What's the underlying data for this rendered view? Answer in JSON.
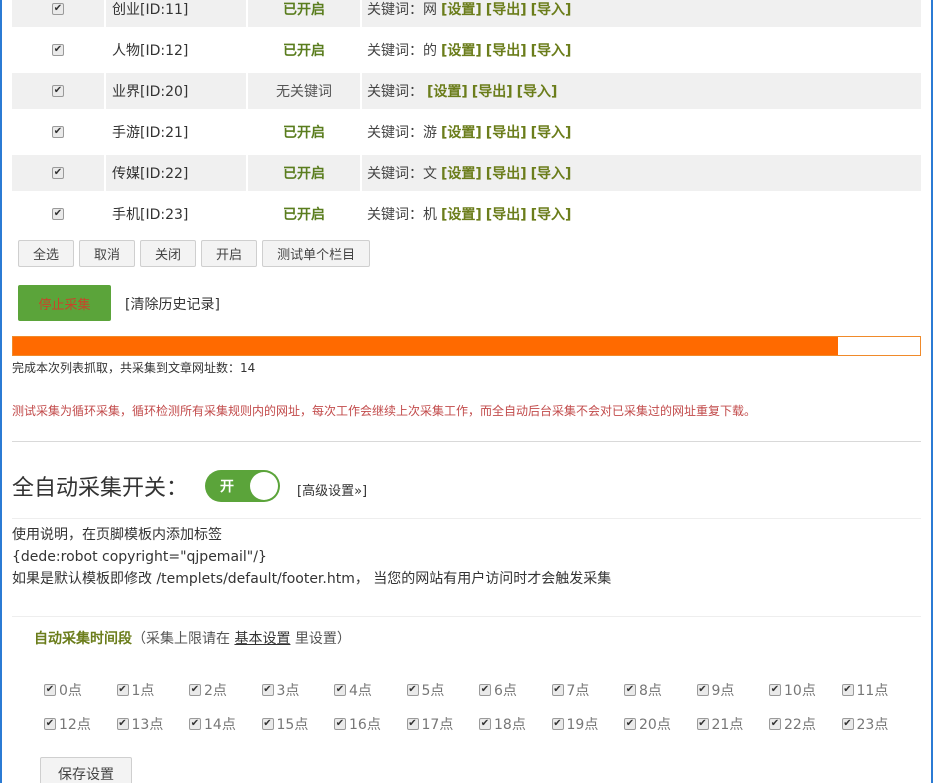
{
  "rows": [
    {
      "name": "创业[ID:11]",
      "status": "已开启",
      "active": true,
      "kw_label": "关键词：网",
      "links": [
        "[设置]",
        "[导出]",
        "[导入]"
      ]
    },
    {
      "name": "人物[ID:12]",
      "status": "已开启",
      "active": true,
      "kw_label": "关键词：的",
      "links": [
        "[设置]",
        "[导出]",
        "[导入]"
      ]
    },
    {
      "name": "业界[ID:20]",
      "status": "无关键词",
      "active": false,
      "kw_label": "关键词：",
      "links": [
        "[设置]",
        "[导出]",
        "[导入]"
      ]
    },
    {
      "name": "手游[ID:21]",
      "status": "已开启",
      "active": true,
      "kw_label": "关键词：游",
      "links": [
        "[设置]",
        "[导出]",
        "[导入]"
      ]
    },
    {
      "name": "传媒[ID:22]",
      "status": "已开启",
      "active": true,
      "kw_label": "关键词：文",
      "links": [
        "[设置]",
        "[导出]",
        "[导入]"
      ]
    },
    {
      "name": "手机[ID:23]",
      "status": "已开启",
      "active": true,
      "kw_label": "关键词：机",
      "links": [
        "[设置]",
        "[导出]",
        "[导入]"
      ]
    }
  ],
  "buttons": {
    "select_all": "全选",
    "cancel": "取消",
    "close": "关闭",
    "open": "开启",
    "test_single": "测试单个栏目"
  },
  "stop_button": "停止采集",
  "clear_history": "[清除历史记录]",
  "progress": {
    "percent": 91,
    "text": "完成本次列表抓取，共采集到文章网址数：14"
  },
  "notice": "测试采集为循环采集，循环检测所有采集规则内的网址，每次工作会继续上次采集工作，而全自动后台采集不会对已采集过的网址重复下载。",
  "auto": {
    "title": "全自动采集开关：",
    "toggle_label": "开",
    "advanced": "[高级设置»]"
  },
  "usage": {
    "line1": "使用说明，在页脚模板内添加标签",
    "line2": "{dede:robot copyright=\"qjpemail\"/}",
    "line3": "如果是默认模板即修改 /templets/default/footer.htm， 当您的网站有用户访问时才会触发采集"
  },
  "time_section": {
    "title": "自动采集时间段",
    "note_prefix": "（采集上限请在",
    "note_link": "基本设置",
    "note_suffix": "里设置）"
  },
  "hours": [
    "0点",
    "1点",
    "2点",
    "3点",
    "4点",
    "5点",
    "6点",
    "7点",
    "8点",
    "9点",
    "10点",
    "11点",
    "12点",
    "13点",
    "14点",
    "15点",
    "16点",
    "17点",
    "18点",
    "19点",
    "20点",
    "21点",
    "22点",
    "23点"
  ],
  "save_button": "保存设置",
  "colors": {
    "accent_green": "#5ba43a",
    "progress_orange": "#ff6a00",
    "frame_blue": "#2b7bd4"
  }
}
